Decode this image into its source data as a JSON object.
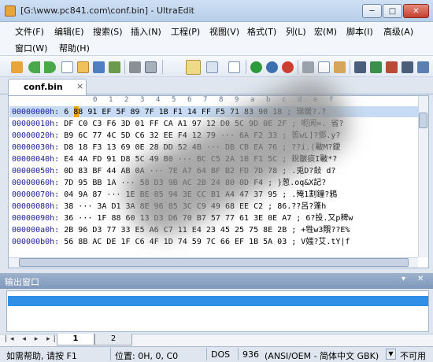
{
  "window": {
    "title": "[G:\\www.pc841.com\\conf.bin] - UltraEdit",
    "min_label": "─",
    "max_label": "□",
    "close_label": "✕"
  },
  "menu": {
    "row1": [
      "文件(F)",
      "编辑(E)",
      "搜索(S)",
      "插入(N)",
      "工程(P)",
      "视图(V)",
      "格式(T)",
      "列(L)",
      "宏(M)",
      "脚本(I)",
      "高级(A)"
    ],
    "row2": [
      "窗口(W)",
      "帮助(H)"
    ]
  },
  "toolbar": {
    "icons": [
      "open-icon",
      "back-icon",
      "forward-icon",
      "new-file-icon",
      "open-folder-icon",
      "save-icon",
      "save-all-icon",
      "print-icon",
      "print-preview-icon",
      "hex-mode-icon",
      "column-mode-icon",
      "word-wrap-icon",
      "go-icon",
      "web-icon",
      "stop-icon",
      "cut-icon",
      "copy-icon",
      "paste-icon",
      "find-icon",
      "replace-icon",
      "find-next-icon",
      "find-prev-icon",
      "find-in-files-icon"
    ]
  },
  "tab": {
    "label": "conf.bin",
    "close": "×"
  },
  "ruler": [
    "0",
    "1",
    "2",
    "3",
    "4",
    "5",
    "6",
    "7",
    "8",
    "9",
    "a",
    "b",
    "c",
    "d",
    "e",
    "f"
  ],
  "hex_rows": [
    {
      "addr": "00000000h:",
      "bytes": "6 88 91 EF 5F 89 7F 1B F1 14 FF F5 71 83 90 18 ;",
      "ascii": "珶媛?.?"
    },
    {
      "addr": "00000010h:",
      "bytes": "DF C0 C3 F6 3D 01 FF CA A1 97 12 D0 5C 9D 0E 2F ;",
      "ascii": "呃阆=. 省?"
    },
    {
      "addr": "00000020h:",
      "bytes": "B9 6C 77 4C 5D C6 32 EE F4 12 79 ··· 6A F2 33 ;",
      "ascii": "筶wL]?鄧.y?"
    },
    {
      "addr": "00000030h:",
      "bytes": "D8 18 F3 13 69 0E 28 DD 52 4B ··· DB CB EA 76 ;",
      "ascii": "??i.(皸M?鑀"
    },
    {
      "addr": "00000040h:",
      "bytes": "E4 4A FD 91 D8 5C 49 B0 ··· BC C5 2A 1B F1 5C ;",
      "ascii": "銳皺痰I皸*?"
    },
    {
      "addr": "00000050h:",
      "bytes": "0D 83 BF 44 AB 0A ··· 7E A7 64 BF B2 FD 7D 78 ;",
      "ascii": ".兎D?鈙 d?"
    },
    {
      "addr": "00000060h:",
      "bytes": "7D 95 BB 1A ··· 58 D3 9B AC 2B 24 80 0D F4 ;",
      "ascii": "}葱.oq&X記?"
    },
    {
      "addr": "00000070h:",
      "bytes": "04 9A 87 ··· 1E BE 85 94 3E CC B1 A4 47 37 95 ;",
      "ascii": ".殗1割鐘?鴉"
    },
    {
      "addr": "00000080h:",
      "bytes": "38 ··· 3A D1 3A 8E 96 85 3C C9 49 68 EE C2 ;",
      "ascii": "86.??呂?蓬h"
    },
    {
      "addr": "00000090h:",
      "bytes": "36 ··· 1F 88 60 13 D3 D6 70 B7 57 77 61 3E 0E A7 ;",
      "ascii": "6?投.又p稗w"
    },
    {
      "addr": "000000a0h:",
      "bytes": "2B 96 D3 77 33 E5 A6 C7 11 E4 23 45 25 75 8E 2B ;",
      "ascii": "+牲w3覸??E%"
    },
    {
      "addr": "000000b0h:",
      "bytes": "56 8B AC DE 1F C6 4F 1D 74 59 7C 66 EF 1B 5A 03 ;",
      "ascii": "V媸?艾.tY|f"
    }
  ],
  "output": {
    "title": "输出窗口",
    "pin": "▾",
    "pin2": "✕"
  },
  "sheet_tabs": [
    "1",
    "2"
  ],
  "status": {
    "help": "如需帮助, 请按 F1",
    "position": "位置: 0H, 0, C0",
    "line_end": "DOS",
    "codepage": "936",
    "encoding": "(ANSI/OEM - 简体中文 GBK)",
    "mode": "不可用"
  }
}
